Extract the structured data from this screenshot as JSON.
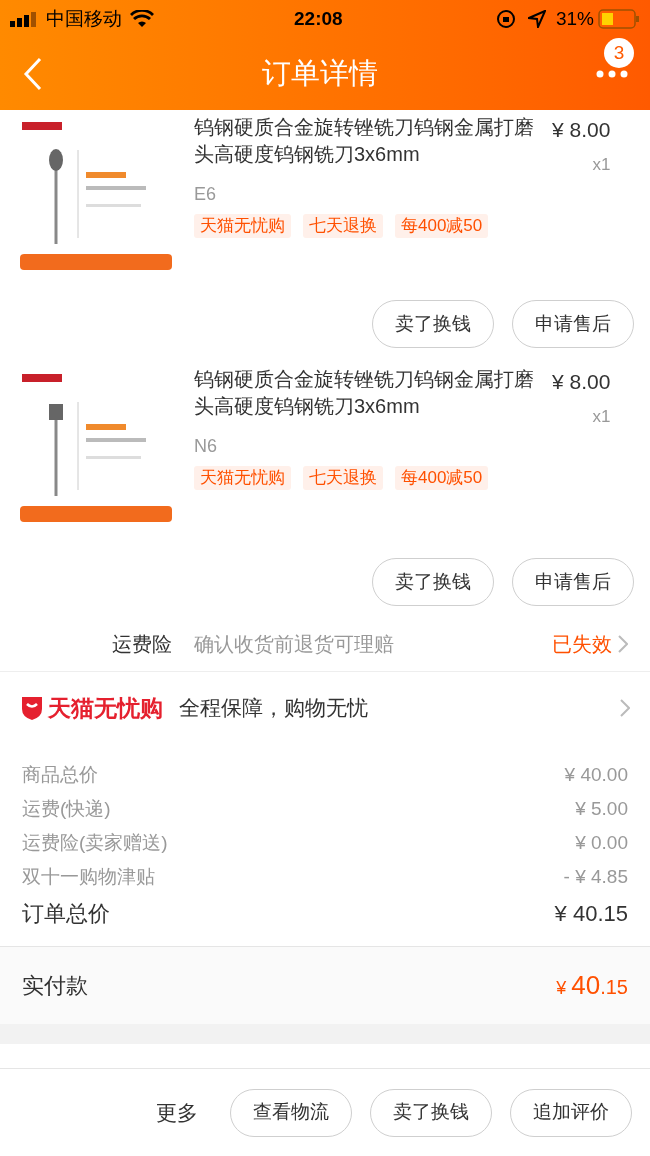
{
  "status_bar": {
    "carrier": "中国移动",
    "time": "22:08",
    "battery": "31%"
  },
  "nav": {
    "title": "订单详情",
    "badge": "3"
  },
  "products": [
    {
      "kind": "picture",
      "title": "钨钢硬质合金旋转锉铣刀钨钢金属打磨头高硬度钨钢铣刀3x6mm",
      "price": "¥ 8.00",
      "qty": "x1",
      "sku": "E6",
      "tags": [
        "天猫无忧购",
        "七天退换",
        "每400减50"
      ],
      "buttons": [
        "卖了换钱",
        "申请售后"
      ]
    },
    {
      "kind": "picture",
      "title": "钨钢硬质合金旋转锉铣刀钨钢金属打磨头高硬度钨钢铣刀3x6mm",
      "price": "¥ 8.00",
      "qty": "x1",
      "sku": "N6",
      "tags": [
        "天猫无忧购",
        "七天退换",
        "每400减50"
      ],
      "buttons": [
        "卖了换钱",
        "申请售后"
      ]
    }
  ],
  "insurance": {
    "label": "运费险",
    "desc": "确认收货前退货可理赔",
    "status": "已失效"
  },
  "guarantee": {
    "brand": "天猫无忧购",
    "text": "全程保障，购物无忧"
  },
  "totals": [
    {
      "label": "商品总价",
      "value": "¥ 40.00"
    },
    {
      "label": "运费(快递)",
      "value": "¥ 5.00"
    },
    {
      "label": "运费险(卖家赠送)",
      "value": "¥ 0.00"
    },
    {
      "label": "双十一购物津贴",
      "value": "- ¥ 4.85"
    }
  ],
  "order_total": {
    "label": "订单总价",
    "value": "¥ 40.15"
  },
  "paid": {
    "label": "实付款",
    "currency": "¥",
    "integer": "40",
    "decimal": ".15"
  },
  "bottom_bar": {
    "more": "更多",
    "buttons": [
      "查看物流",
      "卖了换钱",
      "追加评价"
    ]
  }
}
